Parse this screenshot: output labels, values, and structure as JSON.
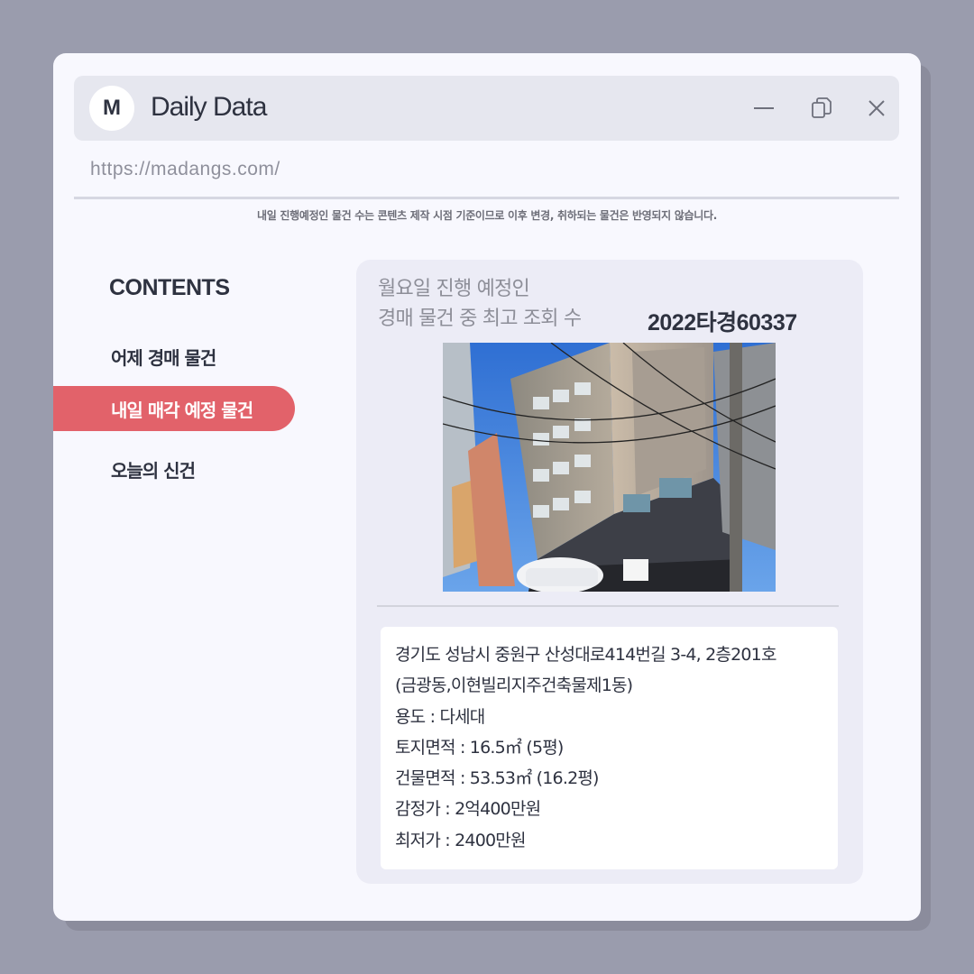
{
  "app": {
    "logo_letter": "M",
    "title": "Daily Data",
    "url": "https://madangs.com/"
  },
  "notice": "내일 진행예정인 물건 수는 콘텐츠 제작 시점 기준이므로 이후 변경, 취하되는 물건은 반영되지 않습니다.",
  "sidebar": {
    "heading": "CONTENTS",
    "items": [
      {
        "label": "어제 경매 물건",
        "active": false
      },
      {
        "label": "내일 매각 예정 물건",
        "active": true
      },
      {
        "label": "오늘의 신건",
        "active": false
      }
    ]
  },
  "card": {
    "heading_line1": "월요일 진행 예정인",
    "heading_line2": "경매 물건 중 최고 조회 수",
    "case_number": "2022타경60337",
    "details": [
      "경기도 성남시 중원구 산성대로414번길 3-4, 2층201호",
      "(금광동,이현빌리지주건축물제1동)",
      "용도 : 다세대",
      "토지면적 : 16.5㎡ (5평)",
      "건물면적 : 53.53㎡ (16.2평)",
      "감정가 : 2억400만원",
      "최저가 : 2400만원"
    ]
  },
  "colors": {
    "accent": "#e2626a",
    "page_bg": "#9a9cad",
    "window_bg": "#f8f8fe",
    "text_dark": "#2e3240"
  },
  "icons": [
    "minimize-icon",
    "restore-icon",
    "close-icon"
  ]
}
